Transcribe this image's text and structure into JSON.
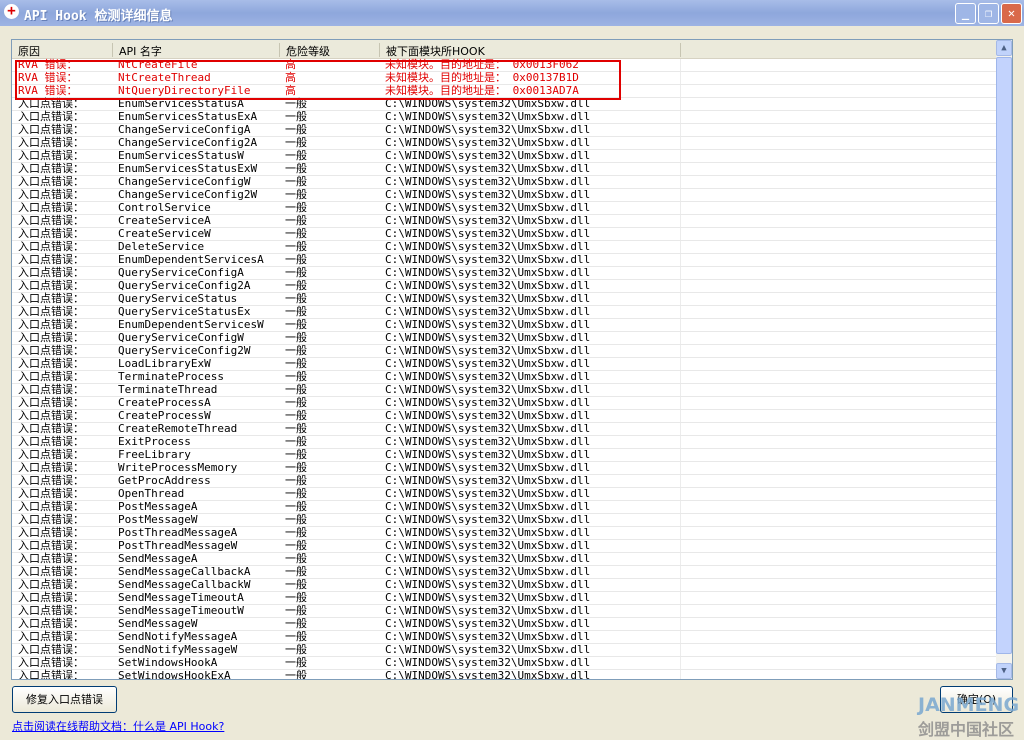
{
  "window": {
    "title": "API Hook 检测详细信息",
    "minimize": "_",
    "restore": "❐",
    "close": "✕"
  },
  "columns": [
    "原因",
    "API 名字",
    "危险等级",
    "被下面模块所HOOK"
  ],
  "red_rows": [
    {
      "reason": "RVA  错误：",
      "api": "NtCreateFile",
      "level": "高",
      "module": "未知模块。目的地址是： 0x0013F062"
    },
    {
      "reason": "RVA  错误：",
      "api": "NtCreateThread",
      "level": "高",
      "module": "未知模块。目的地址是： 0x00137B1D"
    },
    {
      "reason": "RVA  错误：",
      "api": "NtQueryDirectoryFile",
      "level": "高",
      "module": "未知模块。目的地址是： 0x0013AD7A"
    }
  ],
  "entry_reason": "入口点错误：",
  "entry_level": "一般",
  "entry_module": "C:\\WINDOWS\\system32\\UmxSbxw.dll",
  "entry_apis": [
    "EnumServicesStatusA",
    "EnumServicesStatusExA",
    "ChangeServiceConfigA",
    "ChangeServiceConfig2A",
    "EnumServicesStatusW",
    "EnumServicesStatusExW",
    "ChangeServiceConfigW",
    "ChangeServiceConfig2W",
    "ControlService",
    "CreateServiceA",
    "CreateServiceW",
    "DeleteService",
    "EnumDependentServicesA",
    "QueryServiceConfigA",
    "QueryServiceConfig2A",
    "QueryServiceStatus",
    "QueryServiceStatusEx",
    "EnumDependentServicesW",
    "QueryServiceConfigW",
    "QueryServiceConfig2W",
    "LoadLibraryExW",
    "TerminateProcess",
    "TerminateThread",
    "CreateProcessA",
    "CreateProcessW",
    "CreateRemoteThread",
    "ExitProcess",
    "FreeLibrary",
    "WriteProcessMemory",
    "GetProcAddress",
    "OpenThread",
    "PostMessageA",
    "PostMessageW",
    "PostThreadMessageA",
    "PostThreadMessageW",
    "SendMessageA",
    "SendMessageCallbackA",
    "SendMessageCallbackW",
    "SendMessageTimeoutA",
    "SendMessageTimeoutW",
    "SendMessageW",
    "SendNotifyMessageA",
    "SendNotifyMessageW",
    "SetWindowsHookA",
    "SetWindowsHookExA"
  ],
  "buttons": {
    "fix": "修复入口点错误",
    "ok": "确定(O)"
  },
  "help_link": "点击阅读在线帮助文档：什么是 API Hook?",
  "watermark": {
    "brand": "JANMENG",
    "sub": "剑盟中国社区"
  }
}
